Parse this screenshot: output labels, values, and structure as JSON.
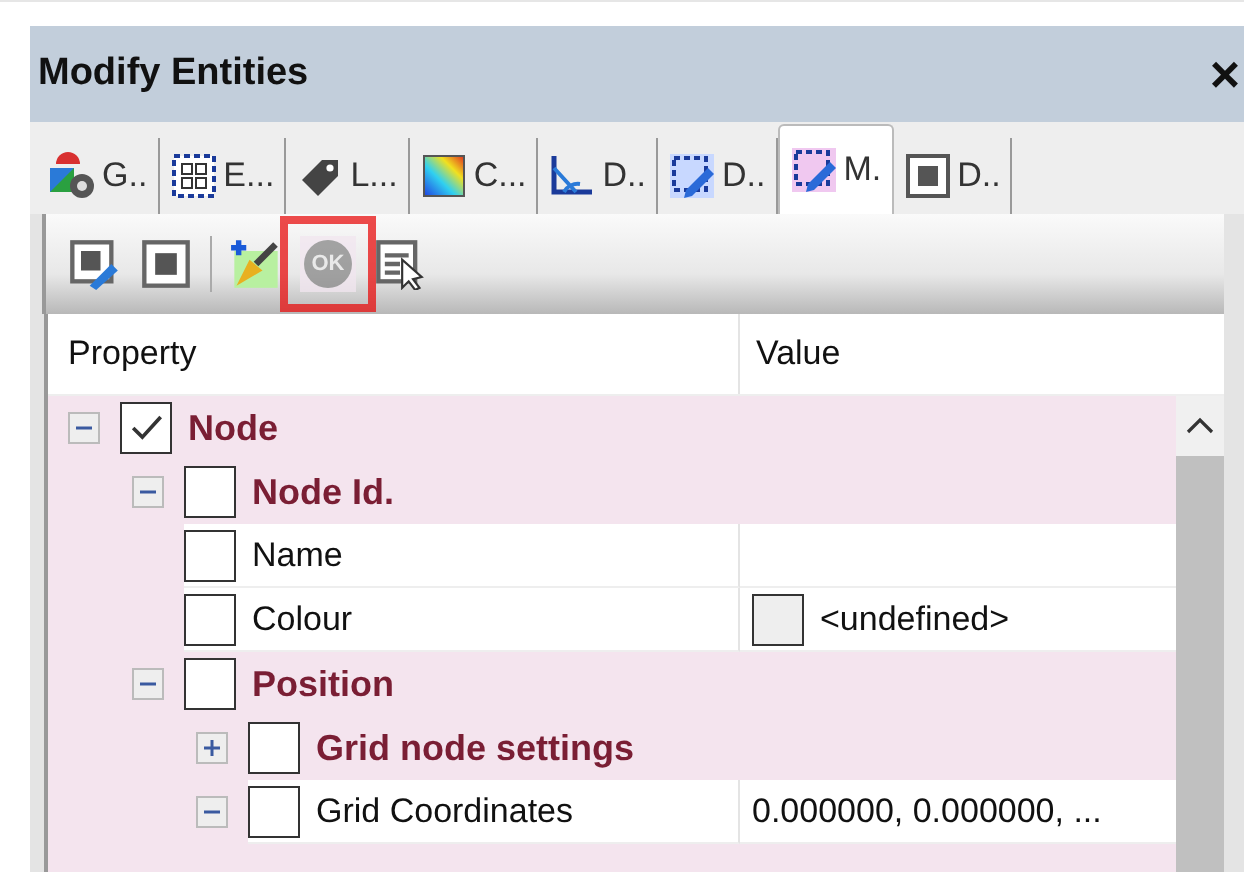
{
  "window": {
    "title": "Modify Entities",
    "close": "×"
  },
  "tabs": [
    {
      "label": "G..",
      "selected": false
    },
    {
      "label": "E...",
      "selected": false
    },
    {
      "label": "L...",
      "selected": false
    },
    {
      "label": "C...",
      "selected": false
    },
    {
      "label": "D..",
      "selected": false
    },
    {
      "label": "D..",
      "selected": false
    },
    {
      "label": "M.",
      "selected": true
    },
    {
      "label": "D..",
      "selected": false
    }
  ],
  "toolbar": [
    {
      "kind": "edit"
    },
    {
      "kind": "stop"
    },
    {
      "kind": "separator"
    },
    {
      "kind": "brush"
    },
    {
      "kind": "ok",
      "label": "OK",
      "disabled": true,
      "highlighted": true
    },
    {
      "kind": "select"
    }
  ],
  "grid": {
    "columns": [
      "Property",
      "Value"
    ],
    "rows": [
      {
        "label": "Node",
        "kind": "category",
        "checked": true,
        "expanded": true,
        "children": [
          {
            "label": "Node Id.",
            "kind": "category",
            "checked": false,
            "expanded": true,
            "children": [
              {
                "label": "Name",
                "kind": "property",
                "checked": false
              },
              {
                "label": "Colour",
                "kind": "property",
                "checked": false,
                "value": "<undefined>",
                "swatch": true
              }
            ]
          },
          {
            "label": "Position",
            "kind": "category",
            "checked": false,
            "expanded": true,
            "children": [
              {
                "label": "Grid node settings",
                "kind": "category",
                "checked": false,
                "expanded": false
              },
              {
                "label": "Grid Coordinates",
                "kind": "property",
                "checked": false,
                "expanded": true,
                "value": "0.000000, 0.000000, ..."
              }
            ]
          }
        ]
      }
    ]
  }
}
